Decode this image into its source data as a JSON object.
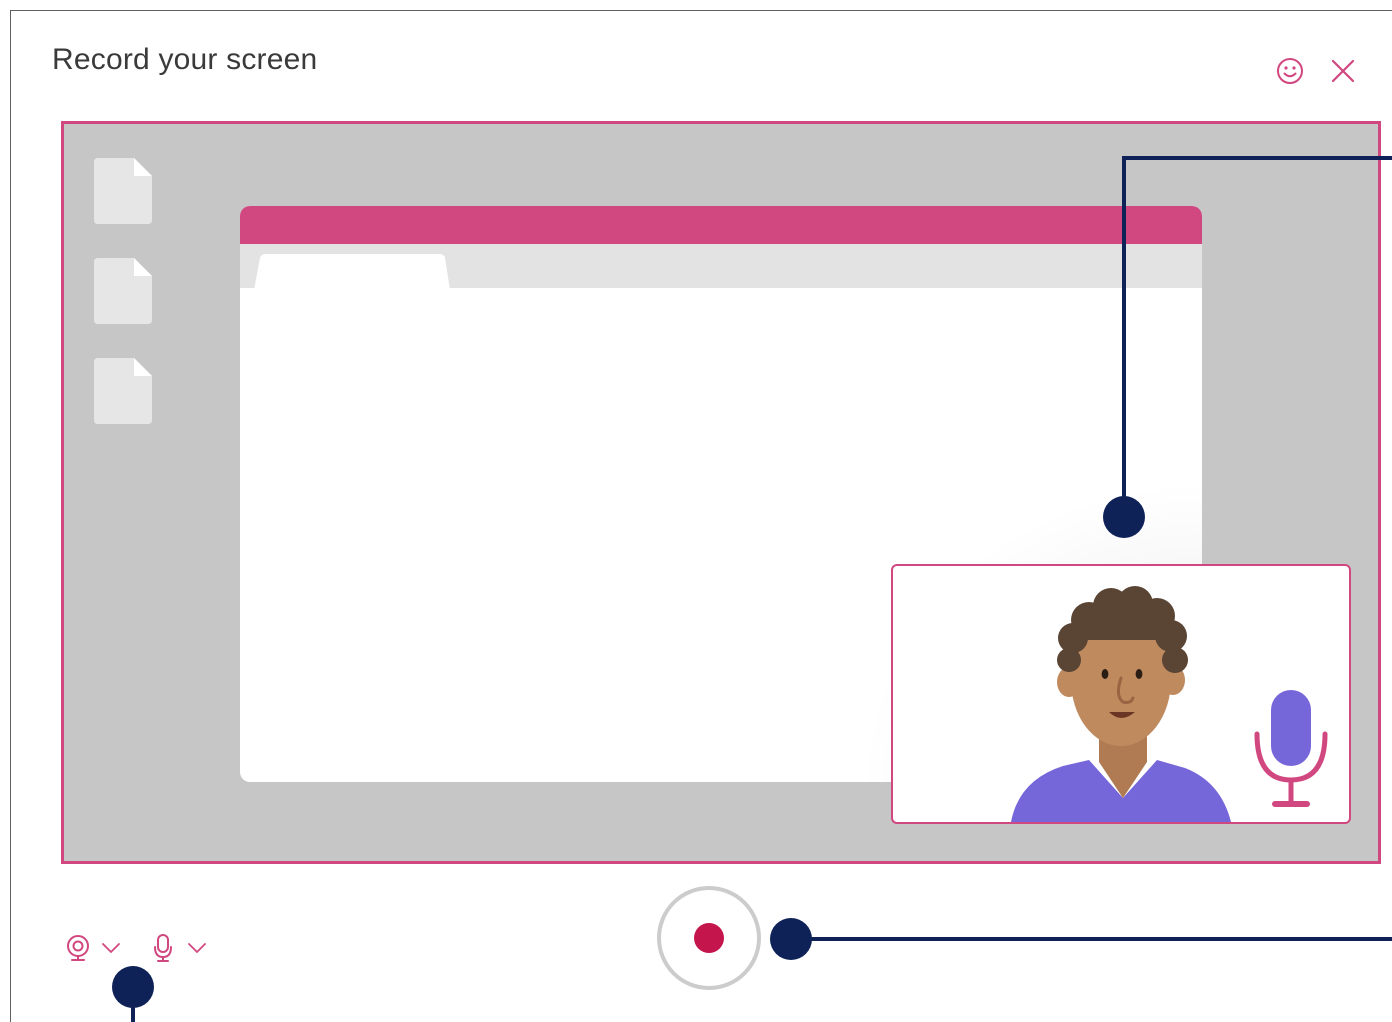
{
  "dialog": {
    "title": "Record your screen"
  },
  "header": {
    "icons": [
      "smiley-feedback-icon",
      "close-icon"
    ]
  },
  "preview": {
    "desktop_file_icons": [
      "file-icon",
      "file-icon",
      "file-icon"
    ],
    "camera_overlay": {
      "icons": [
        "avatar-person",
        "microphone-icon"
      ]
    }
  },
  "controls": {
    "icons": [
      "webcam-icon",
      "chevron-down-icon",
      "microphone-icon",
      "chevron-down-icon",
      "record-icon"
    ]
  },
  "colors": {
    "accent_pink": "#d1477f",
    "record_red": "#c4154c",
    "annotation_navy": "#0e2257",
    "preview_gray": "#c6c6c6",
    "avatar_shirt": "#7566d9",
    "mic_head": "#7566d9"
  }
}
